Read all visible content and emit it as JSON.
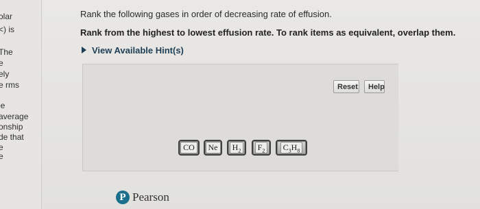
{
  "left_panel": {
    "fragments": [
      "olar",
      "<) is",
      "The",
      "e",
      "ely",
      "e rms",
      "le",
      "average",
      "onship",
      "de that",
      "e",
      "e"
    ]
  },
  "question": {
    "prompt": "Rank the following gases in order of decreasing rate of effusion.",
    "instruction": "Rank from the highest to lowest effusion rate. To rank items as equivalent, overlap them.",
    "hints_label": "View Available Hint(s)"
  },
  "workspace": {
    "reset_label": "Reset",
    "help_label": "Help",
    "tiles": [
      {
        "base": "CO",
        "sub": ""
      },
      {
        "base": "Ne",
        "sub": ""
      },
      {
        "base": "H",
        "sub": "2"
      },
      {
        "base": "F",
        "sub": "2"
      },
      {
        "base": "C",
        "sub": "3",
        "base2": "H",
        "sub2": "8"
      }
    ]
  },
  "footer": {
    "brand_letter": "P",
    "brand_name": "Pearson"
  },
  "colors": {
    "hint_link": "#1d3d55",
    "pearson_logo": "#1a6f8c"
  }
}
